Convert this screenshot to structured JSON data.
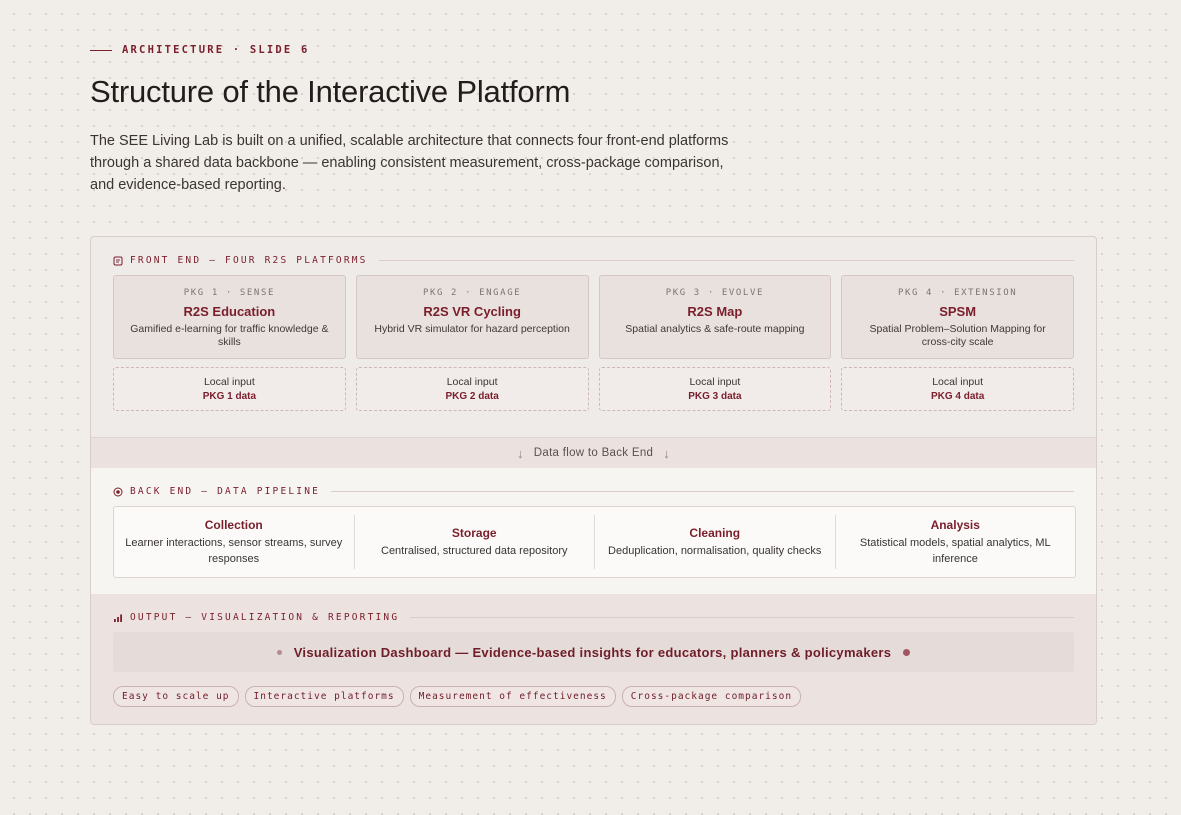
{
  "header": {
    "eyebrow": "ARCHITECTURE · SLIDE 6",
    "title": "Structure of the Interactive Platform",
    "lede": "The SEE Living Lab is built on a unified, scalable architecture that connects four front-end platforms through a shared data backbone — enabling consistent measurement, cross-package comparison, and evidence-based reporting."
  },
  "front_end": {
    "heading": "FRONT END — FOUR R2S PLATFORMS",
    "packages": [
      {
        "tag": "PKG 1 · SENSE",
        "name": "R2S Education",
        "desc": "Gamified e-learning for traffic knowledge & skills",
        "local_label": "Local input",
        "local_data": "PKG 1 data"
      },
      {
        "tag": "PKG 2 · ENGAGE",
        "name": "R2S VR Cycling",
        "desc": "Hybrid VR simulator for hazard perception",
        "local_label": "Local input",
        "local_data": "PKG 2 data"
      },
      {
        "tag": "PKG 3 · EVOLVE",
        "name": "R2S Map",
        "desc": "Spatial analytics & safe-route mapping",
        "local_label": "Local input",
        "local_data": "PKG 3 data"
      },
      {
        "tag": "PKG 4 · EXTENSION",
        "name": "SPSM",
        "desc": "Spatial Problem–Solution Mapping for cross-city scale",
        "local_label": "Local input",
        "local_data": "PKG 4 data"
      }
    ]
  },
  "flow": {
    "label": "Data flow to Back End",
    "arrow": "↓"
  },
  "back_end": {
    "heading": "BACK END — DATA PIPELINE",
    "stages": [
      {
        "name": "Collection",
        "desc": "Learner interactions, sensor streams, survey responses"
      },
      {
        "name": "Storage",
        "desc": "Centralised, structured data repository"
      },
      {
        "name": "Cleaning",
        "desc": "Deduplication, normalisation, quality checks"
      },
      {
        "name": "Analysis",
        "desc": "Statistical models, spatial analytics, ML inference"
      }
    ]
  },
  "output": {
    "heading": "OUTPUT — VISUALIZATION & REPORTING",
    "dashboard": "Visualization Dashboard — Evidence-based insights for educators, planners & policymakers",
    "tags": [
      "Easy to scale up",
      "Interactive platforms",
      "Measurement of effectiveness",
      "Cross-package comparison"
    ]
  },
  "colors": {
    "accent": "#7a1e2c",
    "background": "#f1ede9"
  },
  "icons": {
    "front_end": "document-icon",
    "back_end": "target-icon",
    "output": "bar-chart-icon"
  }
}
